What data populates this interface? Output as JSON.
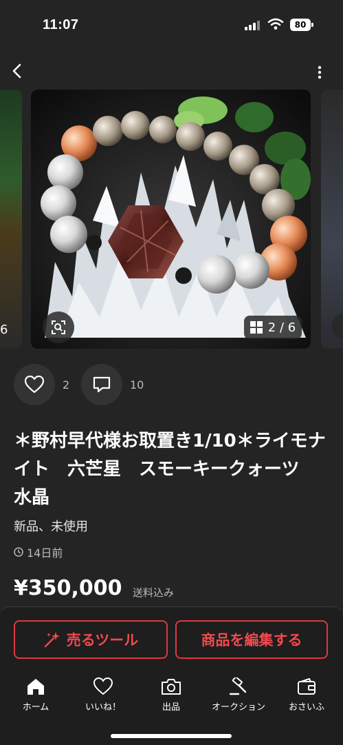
{
  "status_bar": {
    "time": "11:07",
    "battery": "80"
  },
  "gallery": {
    "side_left_number": "6",
    "counter": "2 / 6"
  },
  "actions": {
    "likes": "2",
    "comments": "10"
  },
  "item": {
    "title": "＊野村早代様お取置き1/10＊ライモナイト　六芒星　スモーキークォーツ　水晶",
    "condition": "新品、未使用",
    "posted": "14日前",
    "price": "¥350,000",
    "shipping": "送料込み"
  },
  "buttons": {
    "sell_tool": "売るツール",
    "edit_item": "商品を編集する"
  },
  "tabs": [
    {
      "label": "ホーム",
      "icon": "home-icon"
    },
    {
      "label": "いいね！",
      "icon": "heart-icon"
    },
    {
      "label": "出品",
      "icon": "camera-icon"
    },
    {
      "label": "オークション",
      "icon": "gavel-icon"
    },
    {
      "label": "おさいふ",
      "icon": "wallet-icon"
    }
  ],
  "colors": {
    "background": "#242424",
    "accent": "#e0383e"
  }
}
